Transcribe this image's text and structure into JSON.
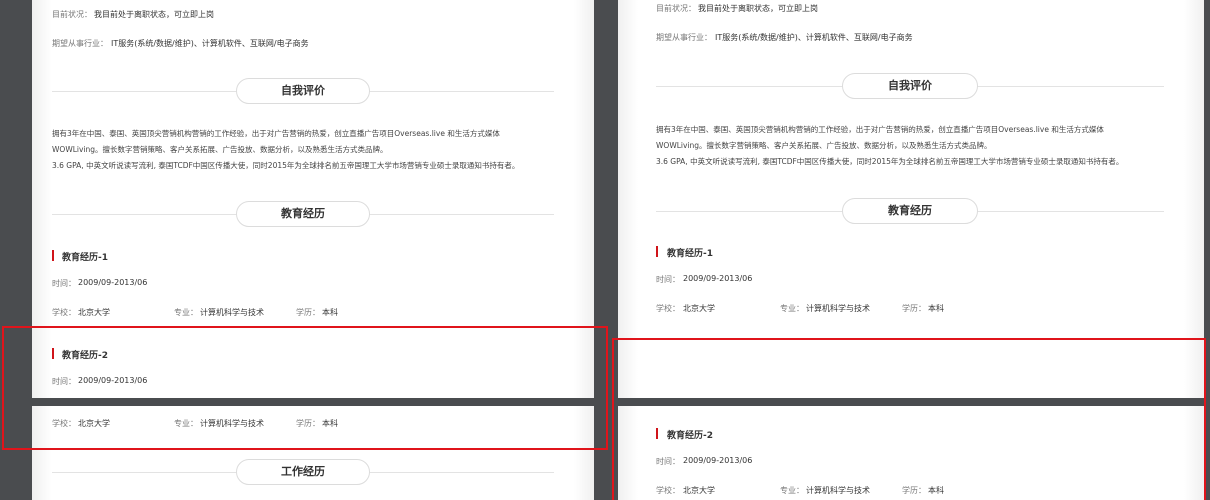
{
  "status": {
    "label": "目前状况：",
    "value": "我目前处于离职状态，可立即上岗"
  },
  "industry": {
    "label": "期望从事行业：",
    "value": "IT服务(系统/数据/维护)、计算机软件、互联网/电子商务"
  },
  "self_eval": {
    "title": "自我评价",
    "lines": [
      "拥有3年在中国、泰国、英国顶尖营销机构营销的工作经验，出于对广告营销的热爱，创立直播广告项目Overseas.live 和生活方式媒体",
      "WOWLiving。擅长数字营销策略、客户关系拓展、广告投放、数据分析，以及熟悉生活方式类品牌。",
      "3.6 GPA, 中英文听说读写流利, 泰国TCDF中国区传播大使，同时2015年为全球排名前五帝国理工大学市场营销专业硕士录取通知书持有者。"
    ]
  },
  "education": {
    "title": "教育经历",
    "items": [
      {
        "heading": "教育经历-1",
        "time_label": "时间：",
        "time": "2009/09-2013/06",
        "school_label": "学校：",
        "school": "北京大学",
        "major_label": "专业：",
        "major": "计算机科学与技术",
        "degree_label": "学历：",
        "degree": "本科"
      },
      {
        "heading": "教育经历-2",
        "time_label": "时间：",
        "time": "2009/09-2013/06",
        "school_label": "学校：",
        "school": "北京大学",
        "major_label": "专业：",
        "major": "计算机科学与技术",
        "degree_label": "学历：",
        "degree": "本科"
      }
    ]
  },
  "work": {
    "title": "工作经历"
  }
}
